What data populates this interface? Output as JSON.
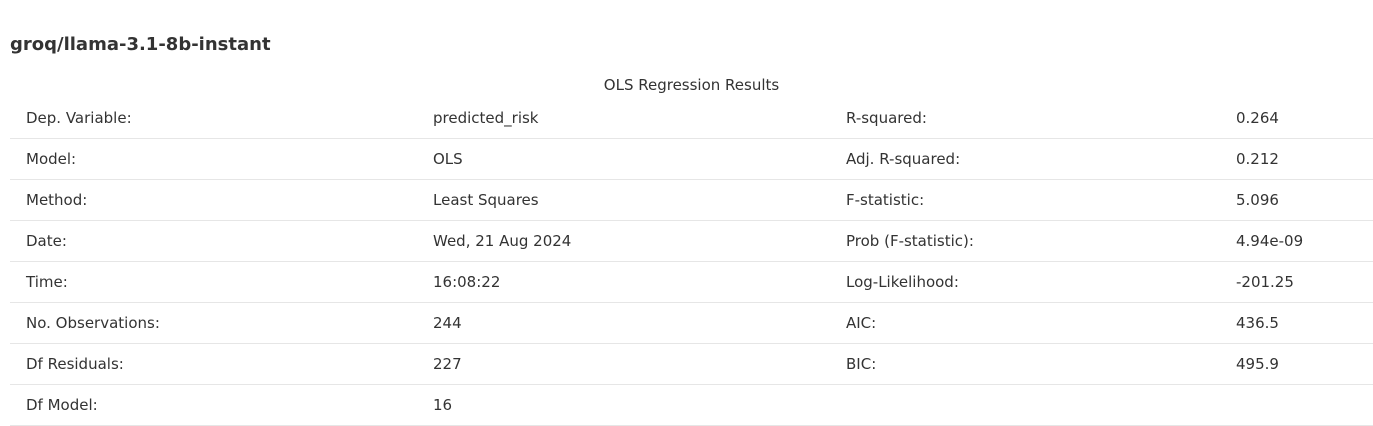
{
  "model_heading": "groq/llama-3.1-8b-instant",
  "caption": "OLS Regression Results",
  "rows": [
    {
      "label1": "Dep. Variable:",
      "value1": "predicted_risk",
      "label2": "R-squared:",
      "value2": "0.264"
    },
    {
      "label1": "Model:",
      "value1": "OLS",
      "label2": "Adj. R-squared:",
      "value2": "0.212"
    },
    {
      "label1": "Method:",
      "value1": "Least Squares",
      "label2": "F-statistic:",
      "value2": "5.096"
    },
    {
      "label1": "Date:",
      "value1": "Wed, 21 Aug 2024",
      "label2": "Prob (F-statistic):",
      "value2": "4.94e-09"
    },
    {
      "label1": "Time:",
      "value1": "16:08:22",
      "label2": "Log-Likelihood:",
      "value2": "-201.25"
    },
    {
      "label1": "No. Observations:",
      "value1": "244",
      "label2": "AIC:",
      "value2": "436.5"
    },
    {
      "label1": "Df Residuals:",
      "value1": "227",
      "label2": "BIC:",
      "value2": "495.9"
    },
    {
      "label1": "Df Model:",
      "value1": "16",
      "label2": "",
      "value2": ""
    }
  ]
}
